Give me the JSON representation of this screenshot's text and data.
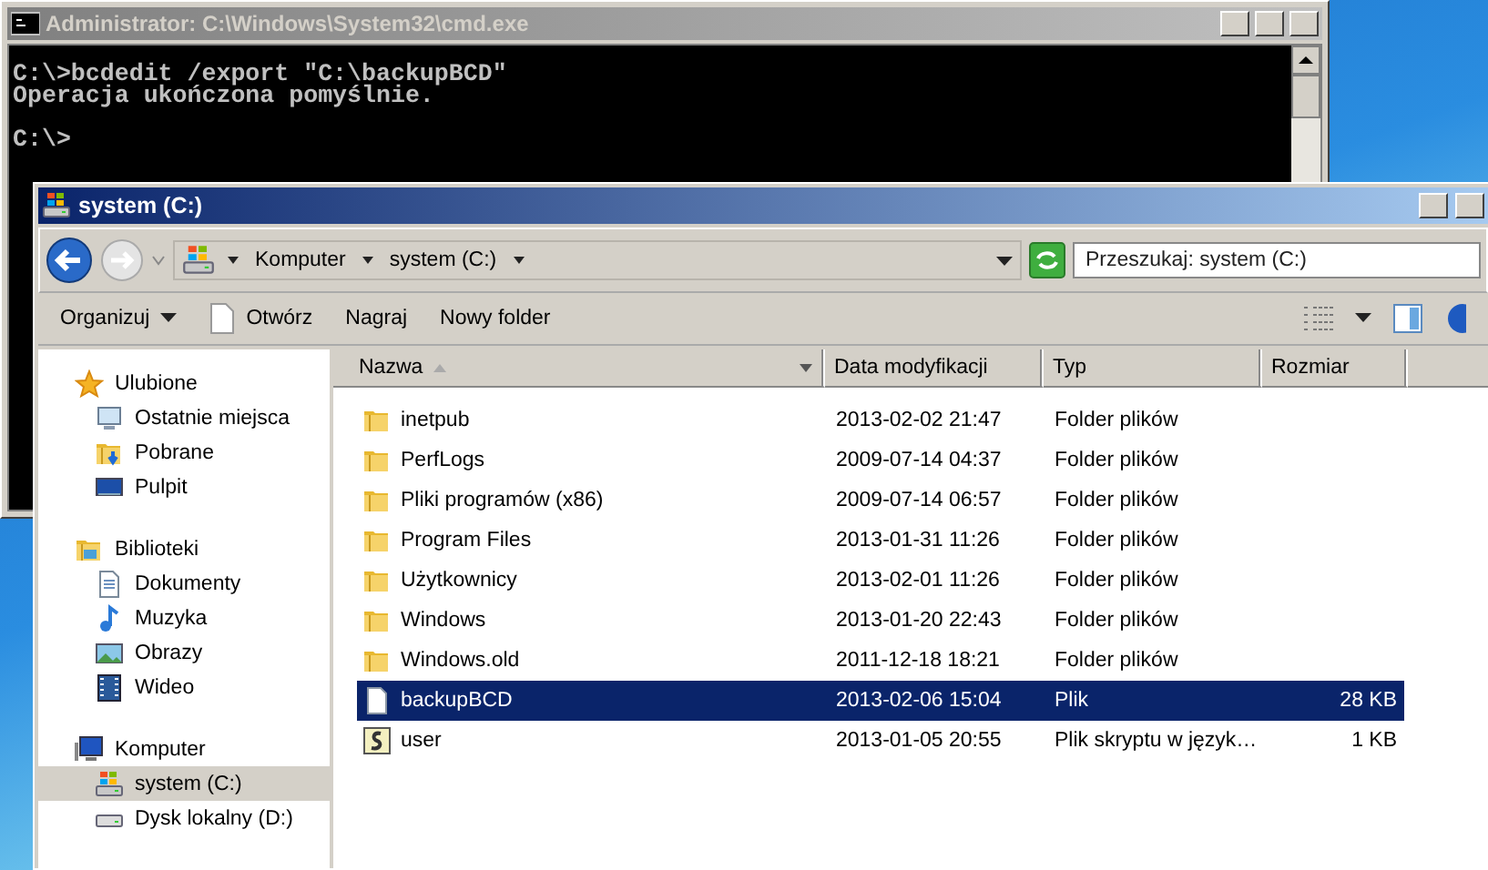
{
  "cmd_window": {
    "title": "Administrator: C:\\Windows\\System32\\cmd.exe",
    "lines": [
      {
        "kind": "command",
        "text": "C:\\>bcdedit /export \"C:\\backupBCD\""
      },
      {
        "kind": "output",
        "text": "Operacja ukończona pomyślnie."
      },
      {
        "kind": "prompt",
        "text": "C:\\>"
      }
    ]
  },
  "explorer_window": {
    "title": "system (C:)",
    "breadcrumb": [
      "Komputer",
      "system (C:)"
    ],
    "search": {
      "placeholder": "Przeszukaj: system (C:)"
    },
    "toolbar": [
      {
        "kind": "menu",
        "label": "Organizuj"
      },
      {
        "kind": "open",
        "label": "Otwórz"
      },
      {
        "kind": "plain",
        "label": "Nagraj"
      },
      {
        "kind": "plain",
        "label": "Nowy folder"
      }
    ],
    "sidebar": [
      {
        "kind": "favorites",
        "label": "Ulubione",
        "selected": false,
        "children": [
          {
            "kind": "recent",
            "label": "Ostatnie miejsca",
            "selected": false
          },
          {
            "kind": "downloads",
            "label": "Pobrane",
            "selected": false
          },
          {
            "kind": "desktop",
            "label": "Pulpit",
            "selected": false
          }
        ]
      },
      {
        "kind": "libraries",
        "label": "Biblioteki",
        "selected": false,
        "children": [
          {
            "kind": "documents",
            "label": "Dokumenty",
            "selected": false
          },
          {
            "kind": "music",
            "label": "Muzyka",
            "selected": false
          },
          {
            "kind": "pictures",
            "label": "Obrazy",
            "selected": false
          },
          {
            "kind": "video",
            "label": "Wideo",
            "selected": false
          }
        ]
      },
      {
        "kind": "computer",
        "label": "Komputer",
        "selected": false,
        "children": [
          {
            "kind": "system-drive",
            "label": "system (C:)",
            "selected": true
          },
          {
            "kind": "drive",
            "label": "Dysk lokalny (D:)",
            "selected": false
          }
        ]
      }
    ],
    "columns": [
      {
        "label": "Nazwa",
        "sorted": true
      },
      {
        "label": "Data modyfikacji",
        "sorted": false
      },
      {
        "label": "Typ",
        "sorted": false
      },
      {
        "label": "Rozmiar",
        "sorted": false
      }
    ],
    "rows": [
      {
        "kind": "folder",
        "name": "inetpub",
        "date": "2013-02-02 21:47",
        "type": "Folder plików",
        "selected": false
      },
      {
        "kind": "folder",
        "name": "PerfLogs",
        "date": "2009-07-14 04:37",
        "type": "Folder plików",
        "selected": false
      },
      {
        "kind": "folder",
        "name": "Pliki programów (x86)",
        "date": "2009-07-14 06:57",
        "type": "Folder plików",
        "selected": false
      },
      {
        "kind": "folder",
        "name": "Program Files",
        "date": "2013-01-31 11:26",
        "type": "Folder plików",
        "selected": false
      },
      {
        "kind": "folder",
        "name": "Użytkownicy",
        "date": "2013-02-01 11:26",
        "type": "Folder plików",
        "selected": false
      },
      {
        "kind": "folder",
        "name": "Windows",
        "date": "2013-01-20 22:43",
        "type": "Folder plików",
        "selected": false
      },
      {
        "kind": "folder",
        "name": "Windows.old",
        "date": "2011-12-18 18:21",
        "type": "Folder plików",
        "selected": false
      },
      {
        "kind": "file",
        "name": "backupBCD",
        "date": "2013-02-06 15:04",
        "type": "Plik",
        "size": "28 KB",
        "selected": true
      },
      {
        "kind": "script",
        "name": "user",
        "date": "2013-01-05 20:55",
        "type": "Plik skryptu w język…",
        "size": "1 KB",
        "selected": false
      }
    ]
  }
}
